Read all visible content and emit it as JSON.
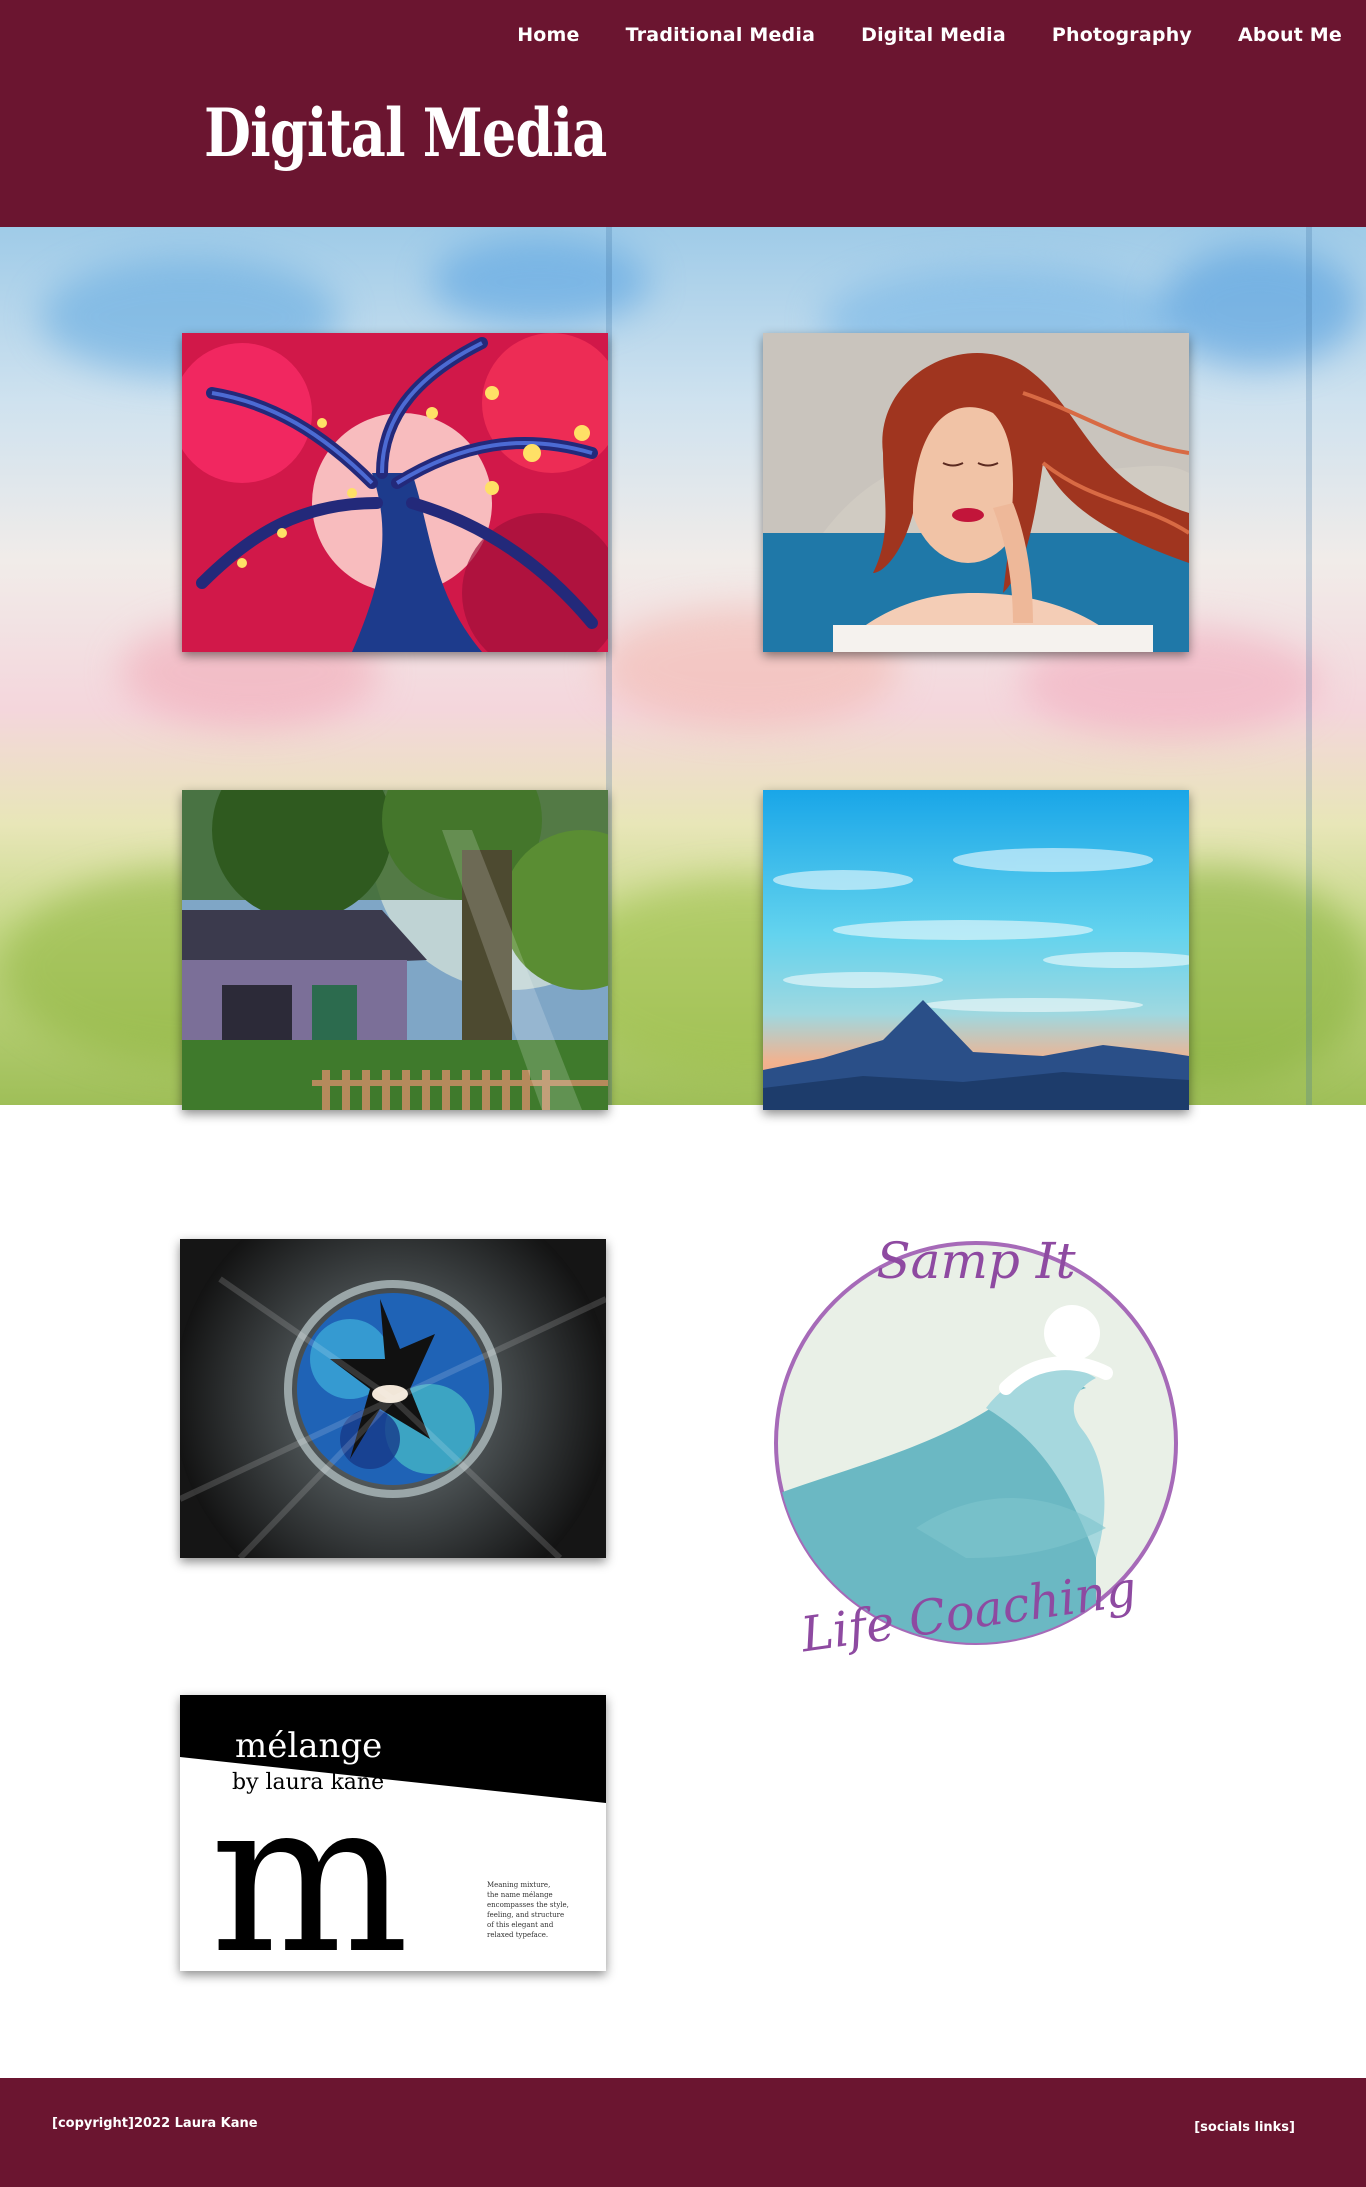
{
  "nav": {
    "items": [
      {
        "label": "Home"
      },
      {
        "label": "Traditional Media"
      },
      {
        "label": "Digital Media"
      },
      {
        "label": "Photography"
      },
      {
        "label": "About Me"
      }
    ]
  },
  "header": {
    "title": "Digital Media"
  },
  "gallery": {
    "melange": {
      "title": "mélange",
      "subtitle": "by laura kane",
      "letter": "m",
      "caption": [
        "Meaning mixture,",
        "the name mélange",
        "encompasses the style,",
        "feeling, and structure",
        "of this elegant and",
        "relaxed typeface."
      ]
    },
    "logo": {
      "top_text": "Samp It",
      "bottom_text": "Life Coaching"
    }
  },
  "footer": {
    "copyright": "[copyright]2022 Laura Kane",
    "socials": "[socials links]"
  },
  "colors": {
    "brand": "#6b1530",
    "text_on_brand": "#ffffff"
  }
}
